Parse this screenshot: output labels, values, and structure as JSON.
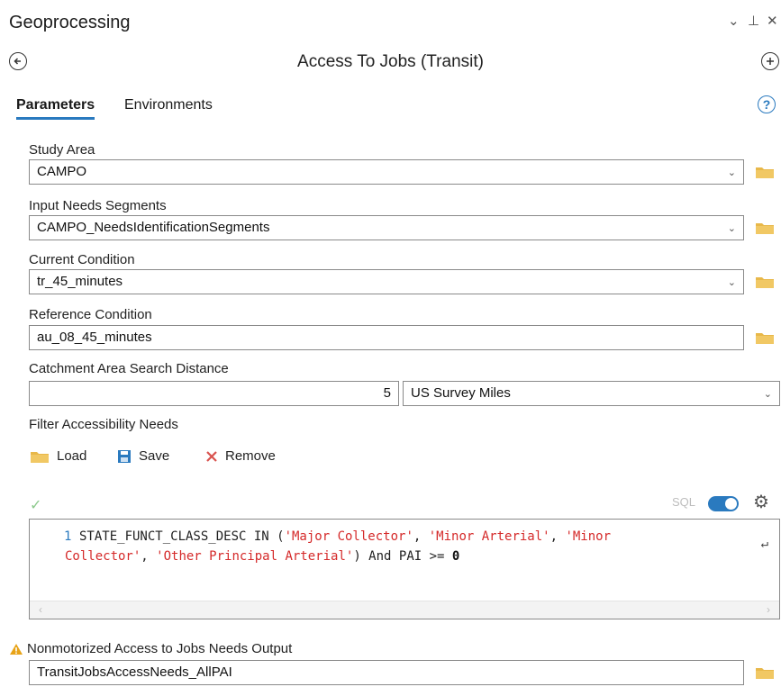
{
  "pane": {
    "title": "Geoprocessing",
    "controls": {
      "dropdown": "⌄",
      "pin": "⊥",
      "close": "✕"
    }
  },
  "tool": {
    "title": "Access To Jobs (Transit)",
    "back_icon": "back-icon",
    "add_icon": "add-icon"
  },
  "tabs": [
    {
      "label": "Parameters",
      "active": true
    },
    {
      "label": "Environments",
      "active": false
    }
  ],
  "help_label": "?",
  "params": {
    "study_area": {
      "label": "Study Area",
      "value": "CAMPO"
    },
    "input_needs": {
      "label": "Input Needs Segments",
      "value": "CAMPO_NeedsIdentificationSegments"
    },
    "current_condition": {
      "label": "Current Condition",
      "value": "tr_45_minutes"
    },
    "reference_condition": {
      "label": "Reference Condition",
      "value": "au_08_45_minutes"
    },
    "catchment": {
      "label": "Catchment Area Search Distance",
      "value": "5",
      "unit": "US Survey Miles"
    },
    "filter": {
      "label": "Filter Accessibility Needs"
    }
  },
  "toolbar": {
    "load": "Load",
    "save": "Save",
    "remove": "Remove"
  },
  "sql": {
    "label": "SQL",
    "enabled": true,
    "line_number": "1",
    "line1_prefix": "STATE_FUNCT_CLASS_DESC IN (",
    "str1": "'Major Collector'",
    "sep1": ", ",
    "str2": "'Minor Arterial'",
    "sep2": ", ",
    "str3a": "'Minor",
    "str3b": "Collector'",
    "sep3": ", ",
    "str4": "'Other Principal Arterial'",
    "line2_suffix": ") And PAI >= ",
    "num": "0"
  },
  "output": {
    "label": "Nonmotorized Access to Jobs Needs Output",
    "value": "TransitJobsAccessNeeds_AllPAI"
  },
  "colors": {
    "accent": "#2a7abf",
    "string": "#d52a2a",
    "folder": "#e8b84a",
    "warning": "#e8a317"
  }
}
